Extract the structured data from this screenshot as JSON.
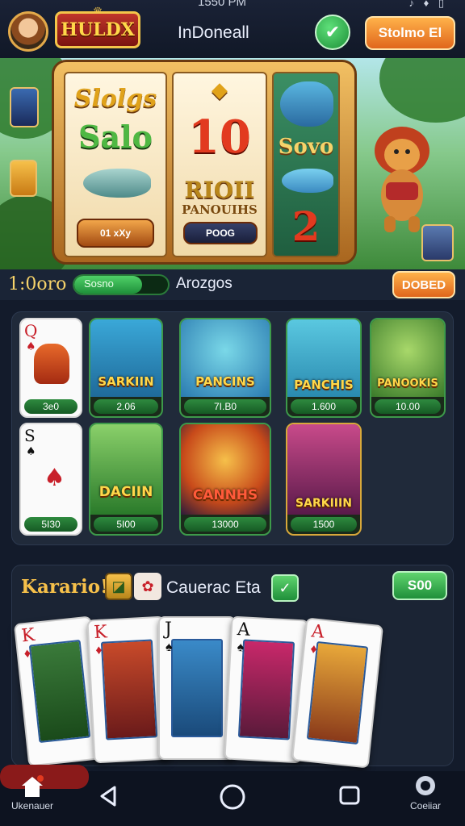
{
  "status_bar": {
    "time": "1550 PM",
    "icons": "♪ ♦ ▯"
  },
  "header": {
    "logo_text": "HULDX",
    "title": "InDoneall",
    "store_button": "Stolmo El"
  },
  "slot_machine": {
    "reel1": [
      "Slolgs",
      "Salo",
      "01 xXy"
    ],
    "reel2": [
      "10",
      "RIOII",
      "PANOUIHS",
      "POOG"
    ],
    "reel3": [
      "Sovo",
      "2"
    ]
  },
  "stats": {
    "coins": "1:0oro",
    "progress_label": "Sosno",
    "progress_fraction": 0.72,
    "label": "Arozgos",
    "button": "DOBED"
  },
  "games": {
    "row1": [
      {
        "name": "",
        "price": "3e0",
        "kind": "card",
        "rank": "Q",
        "suit": "♠"
      },
      {
        "name": "SARKIIN",
        "price": "2.06",
        "kind": "art"
      },
      {
        "name": "PANCINS",
        "price": "7I.B0",
        "kind": "art"
      },
      {
        "name": "PANCHIS",
        "price": "1.600",
        "kind": "art"
      },
      {
        "name": "PANOOKIS",
        "price": "10.00",
        "kind": "art"
      }
    ],
    "row2": [
      {
        "name": "",
        "price": "5I30",
        "kind": "card",
        "rank": "S",
        "suit": "♠"
      },
      {
        "name": "DACIIN",
        "price": "5I00",
        "kind": "art"
      },
      {
        "name": "CANNHS",
        "price": "13000",
        "kind": "art"
      },
      {
        "name": "SARKIIIN",
        "price": "1500",
        "kind": "art"
      }
    ]
  },
  "section2": {
    "title": "Karario!",
    "label": "Cauerac Eta",
    "pill": "S00",
    "cards": [
      {
        "rank": "K",
        "suit": "♦",
        "color": "#c8202a"
      },
      {
        "rank": "K",
        "suit": "♦",
        "color": "#c8202a"
      },
      {
        "rank": "J",
        "suit": "♠",
        "color": "#111"
      },
      {
        "rank": "A",
        "suit": "♠",
        "color": "#111"
      },
      {
        "rank": "A",
        "suit": "♦",
        "color": "#c8202a"
      }
    ]
  },
  "nav": {
    "home_label": "Ukenauer",
    "profile_label": "Coeiiar"
  },
  "colors": {
    "accent_orange": "#e0661c",
    "accent_green": "#1f8f3a",
    "gold": "#f6c04a"
  }
}
